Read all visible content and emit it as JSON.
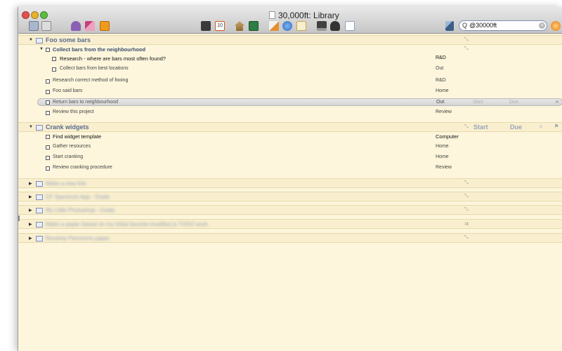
{
  "window": {
    "title": "30,000ft: Library"
  },
  "toolbar": {
    "icons": [
      "view-mode-icon",
      "print-icon",
      "stamp-icon",
      "brush-icon",
      "note-icon",
      "inbox-icon",
      "calendar-icon",
      "home-icon",
      "screen-icon",
      "checkmark-icon",
      "globe-icon",
      "envelope-icon",
      "computer-icon",
      "people-icon",
      "document-icon",
      "wand-icon",
      "refresh-icon"
    ],
    "calendar_day": "10"
  },
  "search": {
    "value": "@30000ft",
    "glass": "Q",
    "clear": "×"
  },
  "columns": {
    "start": "Start",
    "due": "Due"
  },
  "projects": [
    {
      "title": "Foo some bars",
      "groups": [
        {
          "title": "Collect bars from the neighbourhood",
          "tasks": [
            {
              "title": "Research - where are bars most often found?",
              "context": "R&D",
              "bold": true
            },
            {
              "title": "Collect bars from best locations",
              "context": "Out"
            }
          ]
        }
      ],
      "tasks": [
        {
          "title": "Research correct method of fooing",
          "context": "R&D"
        },
        {
          "title": "Foo said bars",
          "context": "Home"
        },
        {
          "title": "Return bars to neighbourhood",
          "context": "Out",
          "start": "Start",
          "due": "Due"
        },
        {
          "title": "Review this project",
          "context": "Review"
        }
      ]
    },
    {
      "title": "Crank widgets",
      "tasks": [
        {
          "title": "Find widget template",
          "context": "Computer",
          "bold": true
        },
        {
          "title": "Gather resources",
          "context": "Home"
        },
        {
          "title": "Start cranking",
          "context": "Home"
        },
        {
          "title": "Review cranking procedure",
          "context": "Review"
        }
      ]
    }
  ],
  "collapsed_projects": [
    {
      "title": "Make a new link"
    },
    {
      "title": "CF Spectrum App - Goals"
    },
    {
      "title": "My Little Photoshop - Goals"
    },
    {
      "title": "Make a paper based on my initial favorite-modified js TODO work"
    },
    {
      "title": "Revamp Pannoons paper"
    }
  ],
  "colors": {
    "background": "#fdf6dc",
    "project_title": "#5a6c8e",
    "search_border": "#7a8fb0"
  }
}
